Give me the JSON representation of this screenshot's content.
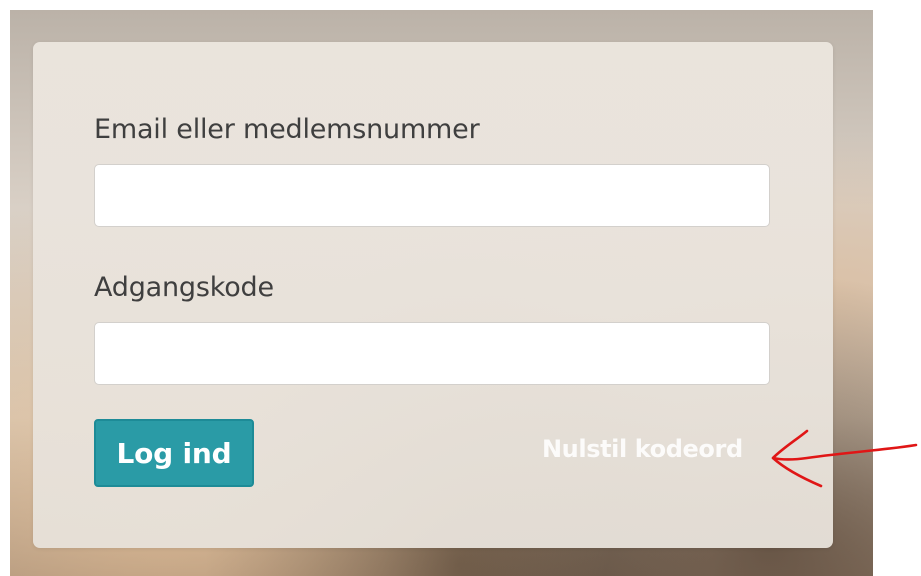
{
  "login_form": {
    "email_label": "Email eller medlemsnummer",
    "email_value": "",
    "password_label": "Adgangskode",
    "password_value": "",
    "submit_label": "Log ind",
    "reset_password_label": "Nulstil kodeord"
  },
  "icons": {
    "annotation": "red-hand-drawn-arrow-icon"
  },
  "colors": {
    "button": "#2a9ba6",
    "annotation": "#e01616"
  }
}
